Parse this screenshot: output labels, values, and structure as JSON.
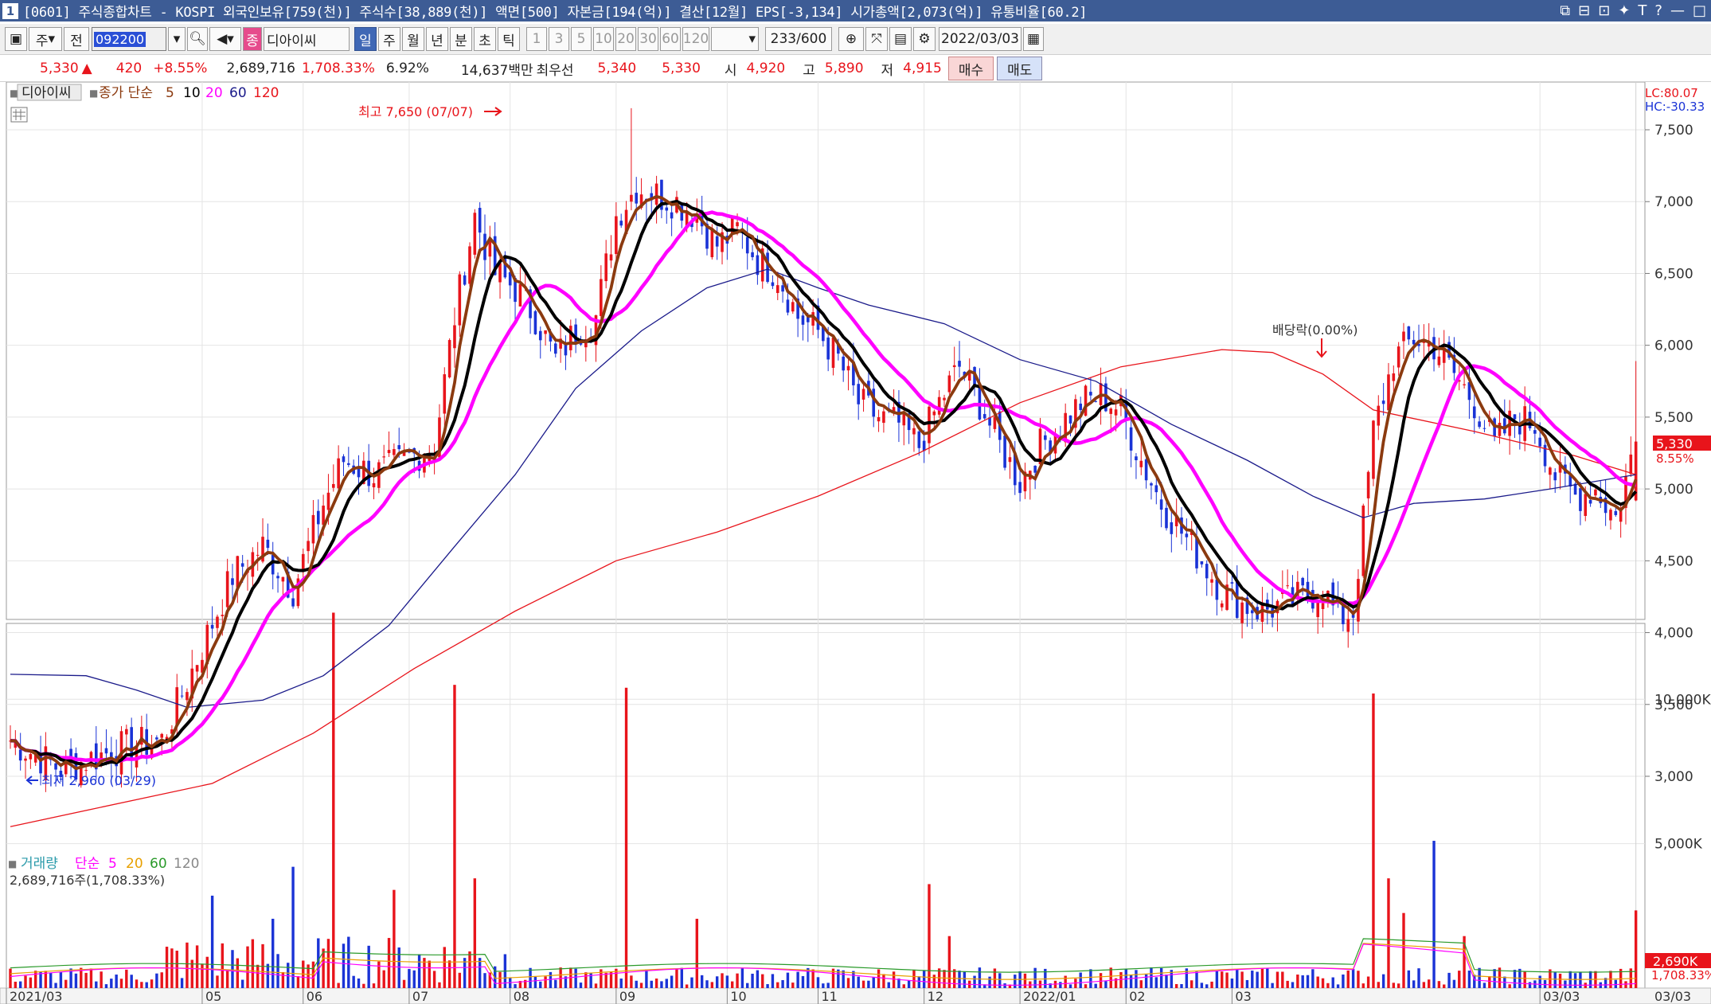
{
  "titlebar": {
    "number": "1",
    "title": "[0601] 주식종합차트 - KOSPI 외국인보유[759(천)] 주식수[38,889(천)] 액면[500] 자본금[194(억)] 결산[12월] EPS[-3,134] 시가총액[2,073(억)] 유통비율[60.2]",
    "controls": [
      "⧉",
      "⊟",
      "⊡",
      "✦",
      "T",
      "?",
      "—",
      "□"
    ]
  },
  "toolbar": {
    "market_btn": "주",
    "prev_btn": "전",
    "code": "092200",
    "type_tag": "종",
    "name": "디아이씨",
    "periods": [
      "일",
      "주",
      "월",
      "년",
      "분",
      "초",
      "틱"
    ],
    "active_period": "일",
    "numbers": [
      "1",
      "3",
      "5",
      "10",
      "20",
      "30",
      "60",
      "120"
    ],
    "count": "233",
    "total": "/600",
    "date": "2022/03/03"
  },
  "quote": {
    "price": "5,330",
    "up_arrow": "▲",
    "change": "420",
    "change_pct": "+8.55%",
    "volume": "2,689,716",
    "volume_pct": "1,708.33%",
    "turnover": "6.92%",
    "amount": "14,637백만",
    "best_label": "최우선",
    "best_ask": "5,340",
    "best_bid": "5,330",
    "open_label": "시",
    "open": "4,920",
    "high_label": "고",
    "high": "5,890",
    "low_label": "저",
    "low": "4,915",
    "buy_btn": "매수",
    "sell_btn": "매도"
  },
  "chart_data": {
    "type": "candlestick",
    "legend": {
      "name": "디아이씨",
      "price_label": "종가 단순",
      "ma_periods": [
        "5",
        "10",
        "20",
        "60",
        "120"
      ],
      "ma_colors": [
        "#8b3a0f",
        "#000000",
        "#ff00ff",
        "#1a1a8a",
        "#e8141b"
      ]
    },
    "annotations": {
      "high_label": "최고 7,650 (07/07)",
      "low_label": "최저 2,960 (03/29)",
      "dividend_label": "배당락(0.00%)"
    },
    "price_axis": {
      "ticks": [
        "7,500",
        "7,000",
        "6,500",
        "6,000",
        "5,500",
        "5,000",
        "4,500",
        "4,000",
        "3,500",
        "3,000"
      ],
      "tick_values": [
        7500,
        7000,
        6500,
        6000,
        5500,
        5000,
        4500,
        4000,
        3500,
        3000
      ],
      "lc": "LC:80.07",
      "hc": "HC:-30.33",
      "last_price": "5,330",
      "last_pct": "8.55%"
    },
    "x_axis": {
      "labels": [
        "2021/03",
        "05",
        "06",
        "07",
        "08",
        "09",
        "10",
        "11",
        "12",
        "2022/01",
        "02",
        "03",
        "03/03"
      ]
    },
    "volume": {
      "legend_name": "거래량",
      "legend_ma": "단순",
      "ma_periods": [
        "5",
        "20",
        "60",
        "120"
      ],
      "ma_colors": [
        "#ff00ff",
        "#e8a000",
        "#2a9a2a",
        "#888888"
      ],
      "info": "2,689,716주(1,708.33%)",
      "ticks": [
        "10,000K",
        "5,000K"
      ],
      "tick_values": [
        10000,
        5000
      ],
      "last": "2,690K",
      "last_pct": "1,708.33%"
    },
    "anchors": [
      {
        "d": 0,
        "c": 3250
      },
      {
        "d": 10,
        "c": 3050
      },
      {
        "d": 22,
        "c": 3200
      },
      {
        "d": 30,
        "c": 3250
      },
      {
        "d": 38,
        "c": 3900
      },
      {
        "d": 44,
        "c": 4400
      },
      {
        "d": 50,
        "c": 4600
      },
      {
        "d": 56,
        "c": 4300
      },
      {
        "d": 62,
        "c": 4900
      },
      {
        "d": 66,
        "c": 5200
      },
      {
        "d": 72,
        "c": 5100
      },
      {
        "d": 78,
        "c": 5200
      },
      {
        "d": 84,
        "c": 5300
      },
      {
        "d": 88,
        "c": 6200
      },
      {
        "d": 92,
        "c": 6900
      },
      {
        "d": 96,
        "c": 6500
      },
      {
        "d": 100,
        "c": 6400
      },
      {
        "d": 104,
        "c": 6200
      },
      {
        "d": 108,
        "c": 5900
      },
      {
        "d": 112,
        "c": 6100
      },
      {
        "d": 116,
        "c": 6200
      },
      {
        "d": 120,
        "c": 6900
      },
      {
        "d": 124,
        "c": 7100
      },
      {
        "d": 128,
        "c": 7050
      },
      {
        "d": 132,
        "c": 7000
      },
      {
        "d": 136,
        "c": 6900
      },
      {
        "d": 140,
        "c": 6700
      },
      {
        "d": 144,
        "c": 6800
      },
      {
        "d": 148,
        "c": 6600
      },
      {
        "d": 152,
        "c": 6500
      },
      {
        "d": 156,
        "c": 6200
      },
      {
        "d": 160,
        "c": 6100
      },
      {
        "d": 164,
        "c": 5900
      },
      {
        "d": 168,
        "c": 5600
      },
      {
        "d": 172,
        "c": 5500
      },
      {
        "d": 176,
        "c": 5450
      },
      {
        "d": 180,
        "c": 5300
      },
      {
        "d": 184,
        "c": 5600
      },
      {
        "d": 188,
        "c": 5850
      },
      {
        "d": 192,
        "c": 5600
      },
      {
        "d": 196,
        "c": 5300
      },
      {
        "d": 200,
        "c": 5050
      },
      {
        "d": 204,
        "c": 5300
      },
      {
        "d": 208,
        "c": 5450
      },
      {
        "d": 212,
        "c": 5600
      },
      {
        "d": 216,
        "c": 5650
      },
      {
        "d": 220,
        "c": 5550
      },
      {
        "d": 224,
        "c": 5200
      },
      {
        "d": 228,
        "c": 4900
      },
      {
        "d": 232,
        "c": 4700
      },
      {
        "d": 236,
        "c": 4500
      },
      {
        "d": 240,
        "c": 4300
      },
      {
        "d": 244,
        "c": 4200
      },
      {
        "d": 248,
        "c": 4150
      },
      {
        "d": 252,
        "c": 4200
      },
      {
        "d": 256,
        "c": 4250
      },
      {
        "d": 260,
        "c": 4300
      },
      {
        "d": 263,
        "c": 4100
      },
      {
        "d": 266,
        "c": 4150
      },
      {
        "d": 270,
        "c": 5400
      },
      {
        "d": 274,
        "c": 5900
      },
      {
        "d": 278,
        "c": 6050
      },
      {
        "d": 282,
        "c": 6000
      },
      {
        "d": 286,
        "c": 5800
      },
      {
        "d": 290,
        "c": 5600
      },
      {
        "d": 294,
        "c": 5300
      },
      {
        "d": 298,
        "c": 5500
      },
      {
        "d": 302,
        "c": 5450
      },
      {
        "d": 306,
        "c": 5100
      },
      {
        "d": 310,
        "c": 4950
      },
      {
        "d": 314,
        "c": 5000
      },
      {
        "d": 318,
        "c": 4800
      },
      {
        "d": 322,
        "c": 5330
      }
    ],
    "ma120": [
      {
        "d": 0,
        "c": 2650
      },
      {
        "d": 40,
        "c": 2950
      },
      {
        "d": 60,
        "c": 3300
      },
      {
        "d": 80,
        "c": 3750
      },
      {
        "d": 100,
        "c": 4150
      },
      {
        "d": 120,
        "c": 4500
      },
      {
        "d": 140,
        "c": 4700
      },
      {
        "d": 160,
        "c": 4950
      },
      {
        "d": 180,
        "c": 5250
      },
      {
        "d": 200,
        "c": 5600
      },
      {
        "d": 220,
        "c": 5850
      },
      {
        "d": 240,
        "c": 5970
      },
      {
        "d": 250,
        "c": 5950
      },
      {
        "d": 260,
        "c": 5800
      },
      {
        "d": 270,
        "c": 5550
      },
      {
        "d": 290,
        "c": 5400
      },
      {
        "d": 310,
        "c": 5230
      },
      {
        "d": 322,
        "c": 5100
      }
    ],
    "ma60": [
      {
        "d": 0,
        "c": 3710
      },
      {
        "d": 15,
        "c": 3700
      },
      {
        "d": 25,
        "c": 3600
      },
      {
        "d": 35,
        "c": 3480
      },
      {
        "d": 50,
        "c": 3530
      },
      {
        "d": 62,
        "c": 3700
      },
      {
        "d": 75,
        "c": 4050
      },
      {
        "d": 88,
        "c": 4600
      },
      {
        "d": 100,
        "c": 5100
      },
      {
        "d": 112,
        "c": 5700
      },
      {
        "d": 125,
        "c": 6100
      },
      {
        "d": 138,
        "c": 6400
      },
      {
        "d": 150,
        "c": 6530
      },
      {
        "d": 160,
        "c": 6400
      },
      {
        "d": 170,
        "c": 6280
      },
      {
        "d": 185,
        "c": 6150
      },
      {
        "d": 200,
        "c": 5900
      },
      {
        "d": 215,
        "c": 5750
      },
      {
        "d": 230,
        "c": 5450
      },
      {
        "d": 245,
        "c": 5200
      },
      {
        "d": 258,
        "c": 4950
      },
      {
        "d": 268,
        "c": 4800
      },
      {
        "d": 278,
        "c": 4900
      },
      {
        "d": 292,
        "c": 4930
      },
      {
        "d": 305,
        "c": 5000
      },
      {
        "d": 322,
        "c": 5100
      }
    ]
  }
}
